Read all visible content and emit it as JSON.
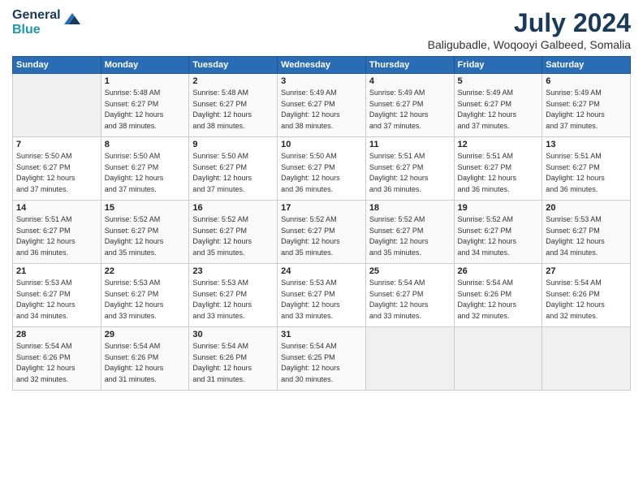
{
  "logo": {
    "line1": "General",
    "line2": "Blue"
  },
  "title": "July 2024",
  "location": "Baligubadle, Woqooyi Galbeed, Somalia",
  "days_of_week": [
    "Sunday",
    "Monday",
    "Tuesday",
    "Wednesday",
    "Thursday",
    "Friday",
    "Saturday"
  ],
  "weeks": [
    [
      {
        "day": "",
        "info": ""
      },
      {
        "day": "1",
        "info": "Sunrise: 5:48 AM\nSunset: 6:27 PM\nDaylight: 12 hours\nand 38 minutes."
      },
      {
        "day": "2",
        "info": "Sunrise: 5:48 AM\nSunset: 6:27 PM\nDaylight: 12 hours\nand 38 minutes."
      },
      {
        "day": "3",
        "info": "Sunrise: 5:49 AM\nSunset: 6:27 PM\nDaylight: 12 hours\nand 38 minutes."
      },
      {
        "day": "4",
        "info": "Sunrise: 5:49 AM\nSunset: 6:27 PM\nDaylight: 12 hours\nand 37 minutes."
      },
      {
        "day": "5",
        "info": "Sunrise: 5:49 AM\nSunset: 6:27 PM\nDaylight: 12 hours\nand 37 minutes."
      },
      {
        "day": "6",
        "info": "Sunrise: 5:49 AM\nSunset: 6:27 PM\nDaylight: 12 hours\nand 37 minutes."
      }
    ],
    [
      {
        "day": "7",
        "info": "Sunrise: 5:50 AM\nSunset: 6:27 PM\nDaylight: 12 hours\nand 37 minutes."
      },
      {
        "day": "8",
        "info": "Sunrise: 5:50 AM\nSunset: 6:27 PM\nDaylight: 12 hours\nand 37 minutes."
      },
      {
        "day": "9",
        "info": "Sunrise: 5:50 AM\nSunset: 6:27 PM\nDaylight: 12 hours\nand 37 minutes."
      },
      {
        "day": "10",
        "info": "Sunrise: 5:50 AM\nSunset: 6:27 PM\nDaylight: 12 hours\nand 36 minutes."
      },
      {
        "day": "11",
        "info": "Sunrise: 5:51 AM\nSunset: 6:27 PM\nDaylight: 12 hours\nand 36 minutes."
      },
      {
        "day": "12",
        "info": "Sunrise: 5:51 AM\nSunset: 6:27 PM\nDaylight: 12 hours\nand 36 minutes."
      },
      {
        "day": "13",
        "info": "Sunrise: 5:51 AM\nSunset: 6:27 PM\nDaylight: 12 hours\nand 36 minutes."
      }
    ],
    [
      {
        "day": "14",
        "info": "Sunrise: 5:51 AM\nSunset: 6:27 PM\nDaylight: 12 hours\nand 36 minutes."
      },
      {
        "day": "15",
        "info": "Sunrise: 5:52 AM\nSunset: 6:27 PM\nDaylight: 12 hours\nand 35 minutes."
      },
      {
        "day": "16",
        "info": "Sunrise: 5:52 AM\nSunset: 6:27 PM\nDaylight: 12 hours\nand 35 minutes."
      },
      {
        "day": "17",
        "info": "Sunrise: 5:52 AM\nSunset: 6:27 PM\nDaylight: 12 hours\nand 35 minutes."
      },
      {
        "day": "18",
        "info": "Sunrise: 5:52 AM\nSunset: 6:27 PM\nDaylight: 12 hours\nand 35 minutes."
      },
      {
        "day": "19",
        "info": "Sunrise: 5:52 AM\nSunset: 6:27 PM\nDaylight: 12 hours\nand 34 minutes."
      },
      {
        "day": "20",
        "info": "Sunrise: 5:53 AM\nSunset: 6:27 PM\nDaylight: 12 hours\nand 34 minutes."
      }
    ],
    [
      {
        "day": "21",
        "info": "Sunrise: 5:53 AM\nSunset: 6:27 PM\nDaylight: 12 hours\nand 34 minutes."
      },
      {
        "day": "22",
        "info": "Sunrise: 5:53 AM\nSunset: 6:27 PM\nDaylight: 12 hours\nand 33 minutes."
      },
      {
        "day": "23",
        "info": "Sunrise: 5:53 AM\nSunset: 6:27 PM\nDaylight: 12 hours\nand 33 minutes."
      },
      {
        "day": "24",
        "info": "Sunrise: 5:53 AM\nSunset: 6:27 PM\nDaylight: 12 hours\nand 33 minutes."
      },
      {
        "day": "25",
        "info": "Sunrise: 5:54 AM\nSunset: 6:27 PM\nDaylight: 12 hours\nand 33 minutes."
      },
      {
        "day": "26",
        "info": "Sunrise: 5:54 AM\nSunset: 6:26 PM\nDaylight: 12 hours\nand 32 minutes."
      },
      {
        "day": "27",
        "info": "Sunrise: 5:54 AM\nSunset: 6:26 PM\nDaylight: 12 hours\nand 32 minutes."
      }
    ],
    [
      {
        "day": "28",
        "info": "Sunrise: 5:54 AM\nSunset: 6:26 PM\nDaylight: 12 hours\nand 32 minutes."
      },
      {
        "day": "29",
        "info": "Sunrise: 5:54 AM\nSunset: 6:26 PM\nDaylight: 12 hours\nand 31 minutes."
      },
      {
        "day": "30",
        "info": "Sunrise: 5:54 AM\nSunset: 6:26 PM\nDaylight: 12 hours\nand 31 minutes."
      },
      {
        "day": "31",
        "info": "Sunrise: 5:54 AM\nSunset: 6:25 PM\nDaylight: 12 hours\nand 30 minutes."
      },
      {
        "day": "",
        "info": ""
      },
      {
        "day": "",
        "info": ""
      },
      {
        "day": "",
        "info": ""
      }
    ]
  ]
}
